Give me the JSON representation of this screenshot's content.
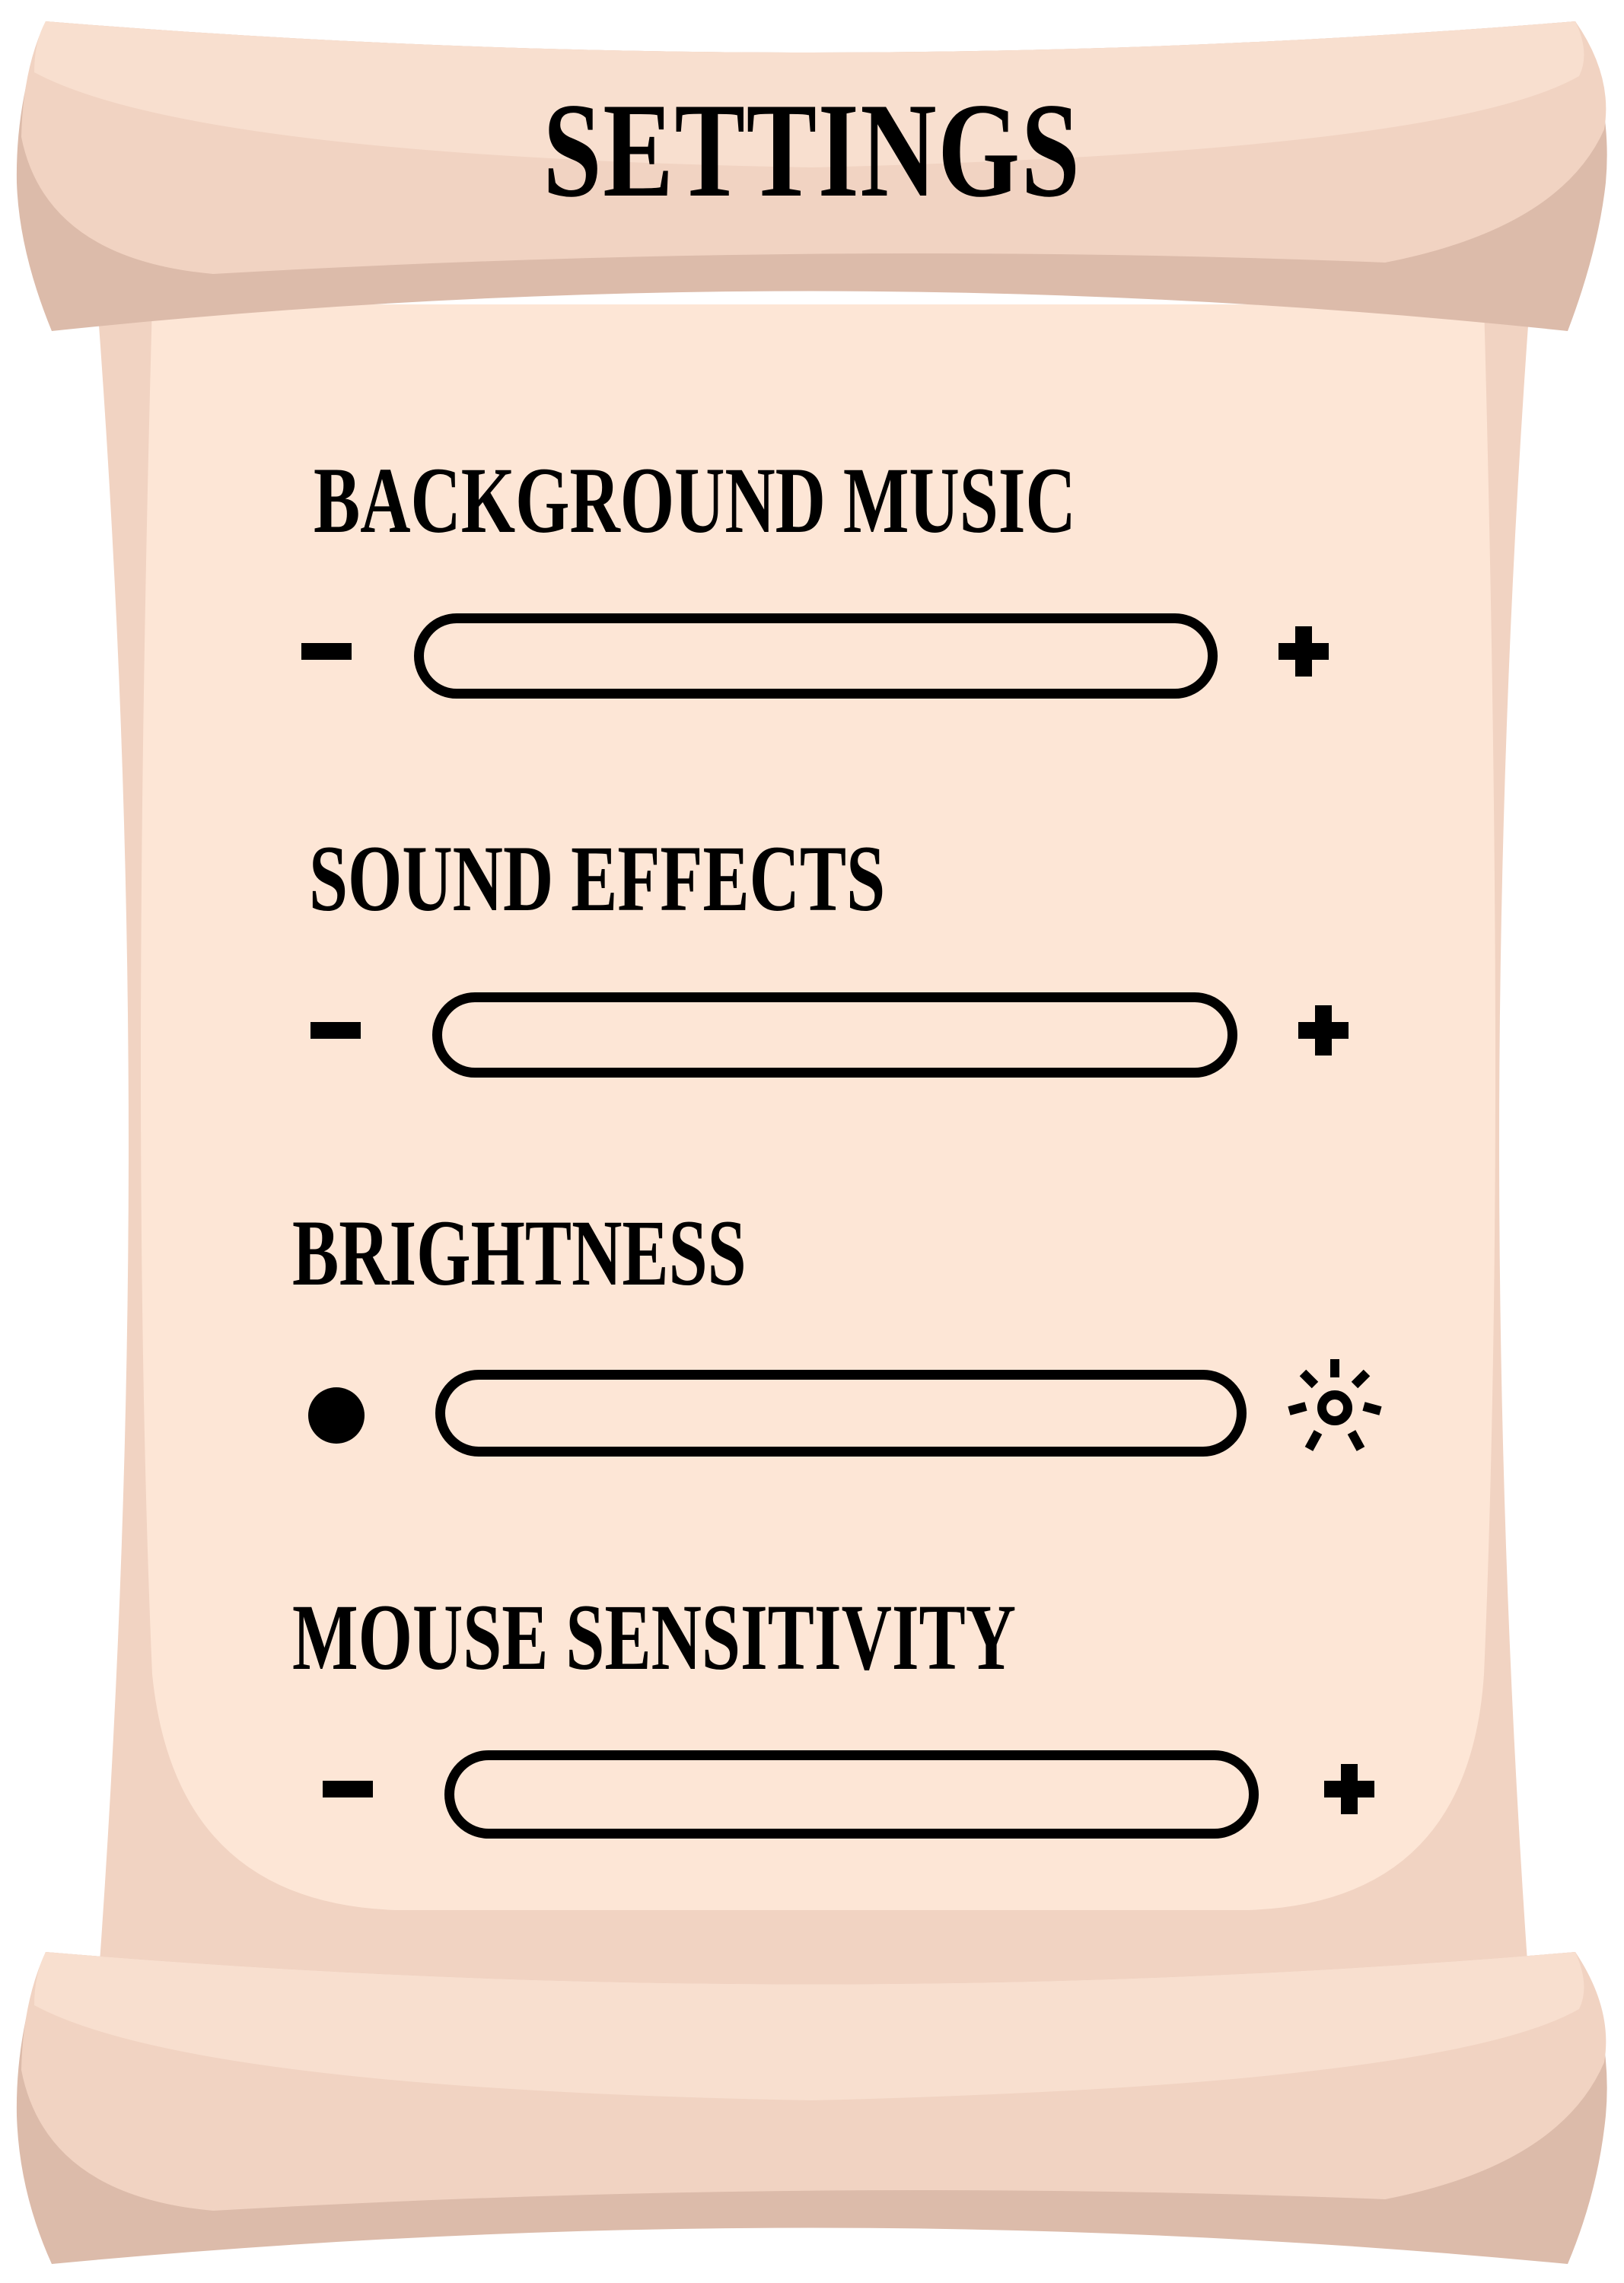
{
  "title": "SETTINGS",
  "settings": [
    {
      "label": "BACKGROUND MUSIC",
      "decrease_icon": "minus-icon",
      "increase_icon": "plus-icon",
      "level": 0
    },
    {
      "label": "SOUND EFFECTS",
      "decrease_icon": "minus-icon",
      "increase_icon": "plus-icon",
      "level": 0
    },
    {
      "label": "BRIGHTNESS",
      "decrease_icon": "dim-dot-icon",
      "increase_icon": "sun-icon",
      "level": 0
    },
    {
      "label": "MOUSE SENSITIVITY",
      "decrease_icon": "minus-icon",
      "increase_icon": "plus-icon",
      "level": 0
    }
  ],
  "colors": {
    "paper": "#fde6d6",
    "paper_shadow": "#f1d3c2",
    "roll_light": "#f6dccb",
    "roll_dark": "#dcbbaa",
    "ink": "#000000"
  }
}
